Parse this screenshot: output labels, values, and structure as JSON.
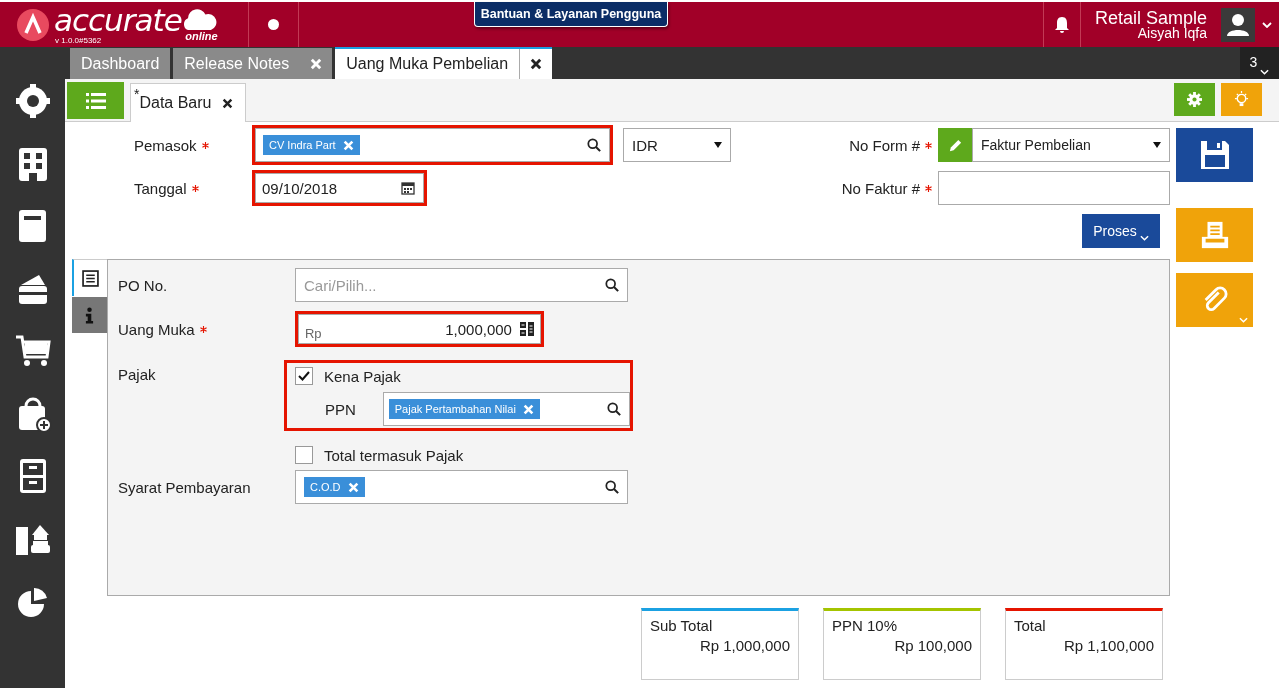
{
  "app": {
    "logo": "accurate",
    "logo_sub": "online",
    "version": "v 1.0.0#5362",
    "help_button": "Bantuan & Layanan Pengguna",
    "company": "Retail Sample",
    "user": "Aisyah Iqfa"
  },
  "tabs": [
    {
      "label": "Dashboard",
      "selected": false,
      "closable": false
    },
    {
      "label": "Release Notes",
      "selected": false,
      "closable": true
    },
    {
      "label": "Uang Muka Pembelian",
      "selected": true,
      "closable": true
    }
  ],
  "tab_count": "3",
  "subtabs": [
    {
      "label": "Data Baru",
      "mark": "*",
      "selected": true
    }
  ],
  "header_form": {
    "supplier": {
      "label": "Pemasok",
      "required": true,
      "tag": "CV Indra Part",
      "highlighted": true
    },
    "currency": "IDR",
    "date": {
      "label": "Tanggal",
      "required": true,
      "value": "09/10/2018",
      "highlighted": true
    },
    "form_no": {
      "label": "No Form #",
      "required": true,
      "value": "Faktur Pembelian"
    },
    "invoice_no": {
      "label": "No Faktur #",
      "required": true
    },
    "process_button": "Proses"
  },
  "side_tabs": [
    {
      "kind": "list",
      "selected": true
    },
    {
      "kind": "info",
      "selected": false
    }
  ],
  "detail": {
    "po_no": {
      "label": "PO No.",
      "placeholder": "Cari/Pilih..."
    },
    "down_payment": {
      "label": "Uang Muka",
      "required": true,
      "prefix": "Rp",
      "value": "1,000,000",
      "highlighted": true
    },
    "tax": {
      "label": "Pajak",
      "highlighted": true,
      "checkbox": {
        "label": "Kena Pajak",
        "checked": true
      },
      "ppn_label": "PPN",
      "ppn_tag": "Pajak Pertambahan Nilai"
    },
    "tax_inclusive": {
      "label": "Total termasuk Pajak",
      "checked": false
    },
    "payment_terms": {
      "label": "Syarat Pembayaran",
      "tag": "C.O.D"
    }
  },
  "totals": [
    {
      "label": "Sub Total",
      "value": "Rp 1,000,000",
      "color": "#1ba1e2"
    },
    {
      "label": "PPN 10%",
      "value": "Rp 100,000",
      "color": "#a4c400"
    },
    {
      "label": "Total",
      "value": "Rp 1,100,000",
      "color": "#e51400"
    }
  ]
}
